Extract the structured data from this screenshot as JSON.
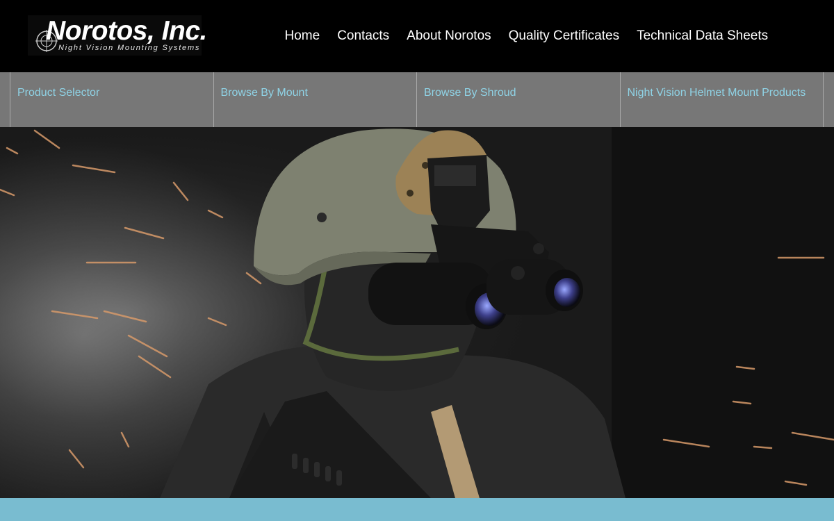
{
  "brand": {
    "name": "Norotos, Inc.",
    "tagline": "Night Vision Mounting Systems"
  },
  "nav": {
    "items": [
      {
        "label": "Home"
      },
      {
        "label": "Contacts"
      },
      {
        "label": "About Norotos"
      },
      {
        "label": "Quality Certificates"
      },
      {
        "label": "Technical Data Sheets"
      }
    ]
  },
  "categories": {
    "items": [
      {
        "label": "Product Selector"
      },
      {
        "label": "Browse By Mount"
      },
      {
        "label": "Browse By Shroud"
      },
      {
        "label": "Night Vision Helmet Mount Products"
      }
    ]
  },
  "hero": {
    "image": "soldier-with-night-vision-goggles-image"
  },
  "colors": {
    "header_bg": "#000000",
    "category_bar_bg": "#777777",
    "category_link": "#8fd3e6",
    "footer_band": "#79bcd0"
  }
}
